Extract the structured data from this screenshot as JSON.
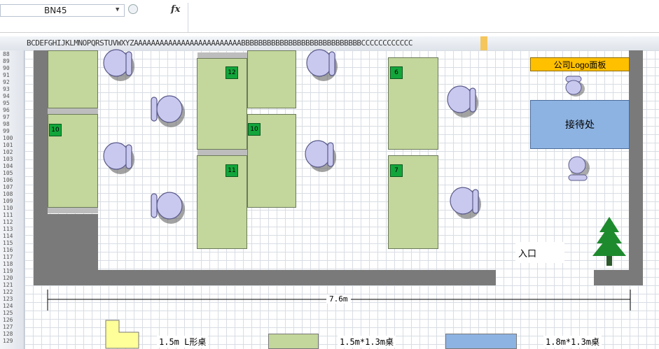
{
  "toolbar": {
    "name_box": "BN45",
    "fx_icon": "function-icon"
  },
  "columns": {
    "header_text": "BCDEFGHIJKLMNOPQRSTUVWXYZAAAAAAAAAAAAAAAAAAAAAAAAABBBBBBBBBBBBBBBBBBBBBBBBBBBBCCCCCCCCCCCC"
  },
  "rows": {
    "labels": [
      "88",
      "89",
      "90",
      "91",
      "92",
      "93",
      "94",
      "95",
      "96",
      "97",
      "98",
      "99",
      "100",
      "101",
      "102",
      "103",
      "104",
      "105",
      "106",
      "107",
      "108",
      "109",
      "110",
      "111",
      "112",
      "113",
      "114",
      "115",
      "116",
      "117",
      "118",
      "119",
      "120",
      "121",
      "122",
      "123",
      "124",
      "125",
      "126",
      "127",
      "128",
      "129"
    ]
  },
  "floorplan": {
    "desks": [
      {
        "number": "12"
      },
      {
        "number": "6"
      },
      {
        "number": "10"
      },
      {
        "number": "10"
      },
      {
        "number": "11"
      },
      {
        "number": "7"
      }
    ],
    "logo_panel": "公司Logo面板",
    "reception": "接待处",
    "entrance": "入口",
    "width_label": "7.6m"
  },
  "legend": {
    "items": [
      {
        "label": "1.5m L形桌",
        "color": "#ffff99"
      },
      {
        "label": "1.5m*1.3m桌",
        "color": "#c3d69b"
      },
      {
        "label": "1.8m*1.3m桌",
        "color": "#8db3e2"
      }
    ]
  },
  "colors": {
    "wall": "#7a7a7a",
    "desk": "#c3d69b",
    "desk_number": "#12a53b",
    "chair": "#c9c9f0",
    "reception": "#8db3e2",
    "logo_panel": "#ffc000",
    "tree": "#1e8a2e"
  }
}
